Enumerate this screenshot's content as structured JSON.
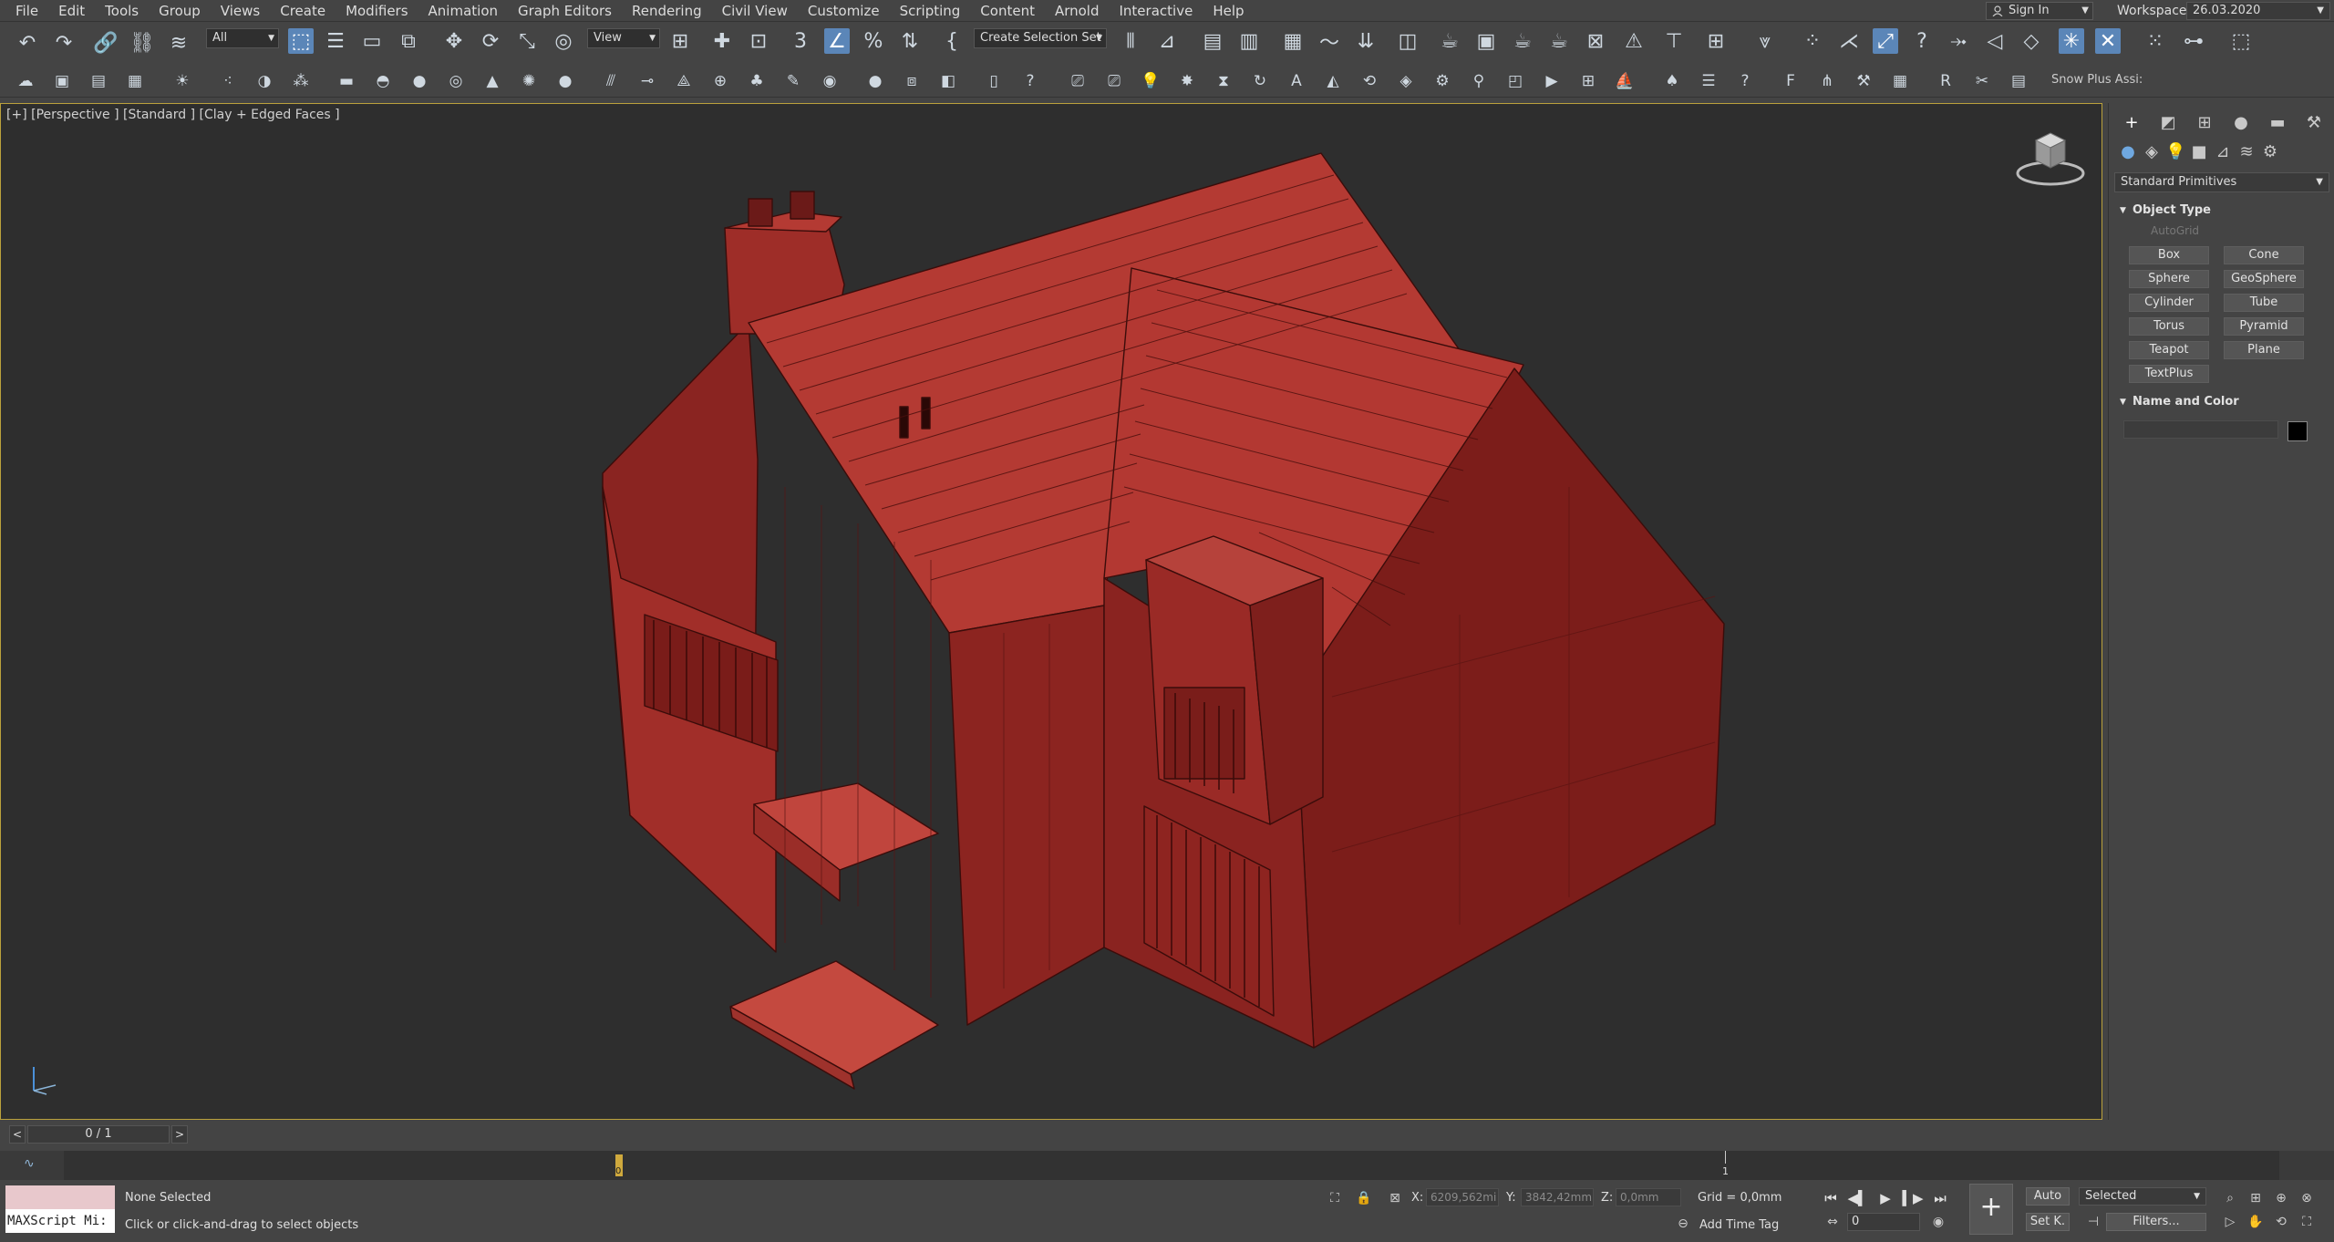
{
  "menubar": {
    "items": [
      "File",
      "Edit",
      "Tools",
      "Group",
      "Views",
      "Create",
      "Modifiers",
      "Animation",
      "Graph Editors",
      "Rendering",
      "Civil View",
      "Customize",
      "Scripting",
      "Content",
      "Arnold",
      "Interactive",
      "Help"
    ],
    "sign_in": "Sign In",
    "workspaces_label": "Workspaces:",
    "workspace_value": "26.03.2020"
  },
  "toolbar1": {
    "filter_value": "All",
    "refcoord_value": "View",
    "selection_set": "Create Selection Set"
  },
  "toolbar2": {
    "snow_plus": "Snow Plus Assi:"
  },
  "viewport": {
    "label": "[+] [Perspective ] [Standard ] [Clay + Edged Faces ]",
    "model_color": "#8c2320",
    "background": "#2e2e2e"
  },
  "command_panel": {
    "category": "Standard Primitives",
    "object_type_title": "Object Type",
    "autogrid": "AutoGrid",
    "primitives": [
      "Box",
      "Cone",
      "Sphere",
      "GeoSphere",
      "Cylinder",
      "Tube",
      "Torus",
      "Pyramid",
      "Teapot",
      "Plane",
      "TextPlus"
    ],
    "name_color_title": "Name and Color"
  },
  "timeline": {
    "frame_counter": "0 / 1",
    "prev": "<",
    "next": ">",
    "marker_zero": "0",
    "marker_one": "1"
  },
  "status": {
    "maxscript": "MAXScript Mi:",
    "selection": "None Selected",
    "prompt": "Click or click-and-drag to select objects",
    "x_label": "X:",
    "x_value": "6209,562mi",
    "y_label": "Y:",
    "y_value": "3842,42mm",
    "z_label": "Z:",
    "z_value": "0,0mm",
    "grid": "Grid = 0,0mm",
    "add_time_tag": "Add Time Tag",
    "auto_key": "Auto",
    "set_key": "Set K.",
    "key_filter": "Selected",
    "filters": "Filters...",
    "frame_value": "0"
  }
}
